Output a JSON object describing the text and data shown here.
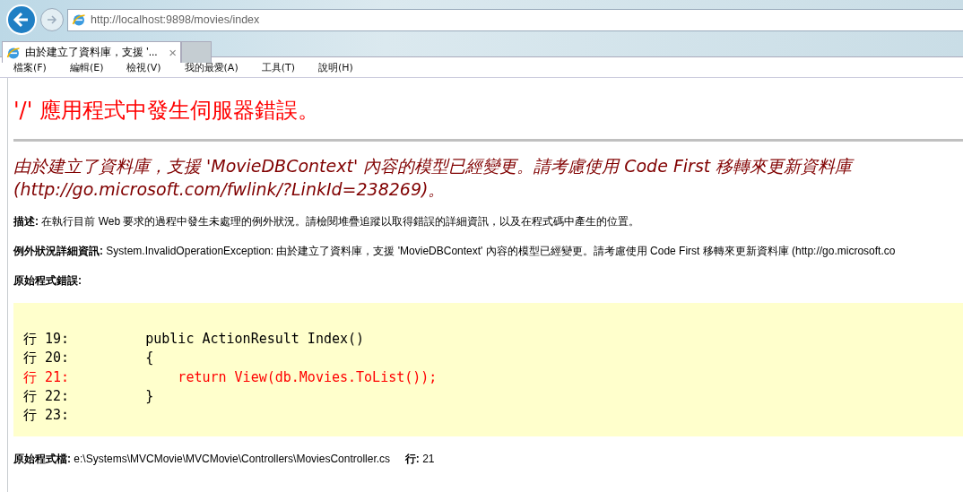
{
  "browser": {
    "address": "http://localhost:9898/movies/index",
    "tabs": [
      {
        "title": "由於建立了資料庫，支援 '...",
        "close": "×",
        "selected": true
      }
    ]
  },
  "menu": [
    "檔案(F)",
    "編輯(E)",
    "檢視(V)",
    "我的最愛(A)",
    "工具(T)",
    "說明(H)"
  ],
  "page": {
    "heading": "'/' 應用程式中發生伺服器錯誤。",
    "message_lines": [
      "由於建立了資料庫，支援 'MovieDBContext' 內容的模型已經變更。請考慮使用 Code First 移轉來更新資料庫",
      "(http://go.microsoft.com/fwlink/?LinkId=238269)。"
    ],
    "description": {
      "label": "描述:",
      "text": "在執行目前 Web 要求的過程中發生未處理的例外狀況。請檢閱堆疊追蹤以取得錯誤的詳細資訊，以及在程式碼中產生的位置。"
    },
    "exception": {
      "label": "例外狀況詳細資訊:",
      "text": "System.InvalidOperationException: 由於建立了資料庫，支援 'MovieDBContext' 內容的模型已經變更。請考慮使用 Code First 移轉來更新資料庫 (http://go.microsoft.co"
    },
    "source_error_label": "原始程式錯誤:",
    "code_lines": [
      {
        "number": "行 19:",
        "code": "        public ActionResult Index()",
        "highlighted": false
      },
      {
        "number": "行 20:",
        "code": "        {",
        "highlighted": false
      },
      {
        "number": "行 21:",
        "code": "            return View(db.Movies.ToList());",
        "highlighted": true
      },
      {
        "number": "行 22:",
        "code": "        }",
        "highlighted": false
      },
      {
        "number": "行 23:",
        "highlighted": false
      }
    ],
    "source_file": {
      "label": "原始程式檔:",
      "path": "e:\\Systems\\MVCMovie\\MVCMovie\\Controllers\\MoviesController.cs",
      "line_label": "行:",
      "line": "21"
    }
  }
}
